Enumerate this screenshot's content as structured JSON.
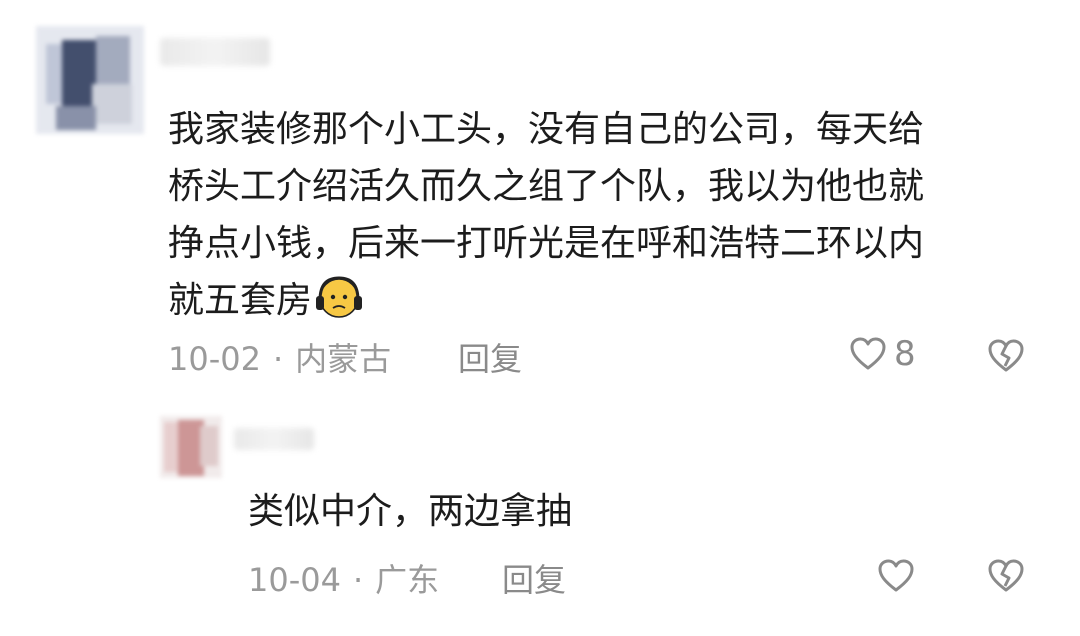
{
  "comments": [
    {
      "text_lines": [
        "我家装修那个小工头，没有自己的公司，每天给",
        "桥头工介绍活久而久之组了个队，我以为他也就",
        "挣点小钱，后来一打听光是在呼和浩特二环以内",
        "就五套房"
      ],
      "emoji": "sad-face-emoji",
      "date": "10-02",
      "separator": "·",
      "location": "内蒙古",
      "reply_label": "回复",
      "like_count": "8",
      "like_icon": "heart-outline-icon",
      "dislike_icon": "broken-heart-icon"
    },
    {
      "text_lines": [
        "类似中介，两边拿抽"
      ],
      "date": "10-04",
      "separator": "·",
      "location": "广东",
      "reply_label": "回复",
      "like_icon": "heart-outline-icon",
      "dislike_icon": "broken-heart-icon"
    }
  ],
  "colors": {
    "text": "#1c1c1c",
    "meta": "#9a9a9a",
    "icon": "#8a8a8a"
  }
}
